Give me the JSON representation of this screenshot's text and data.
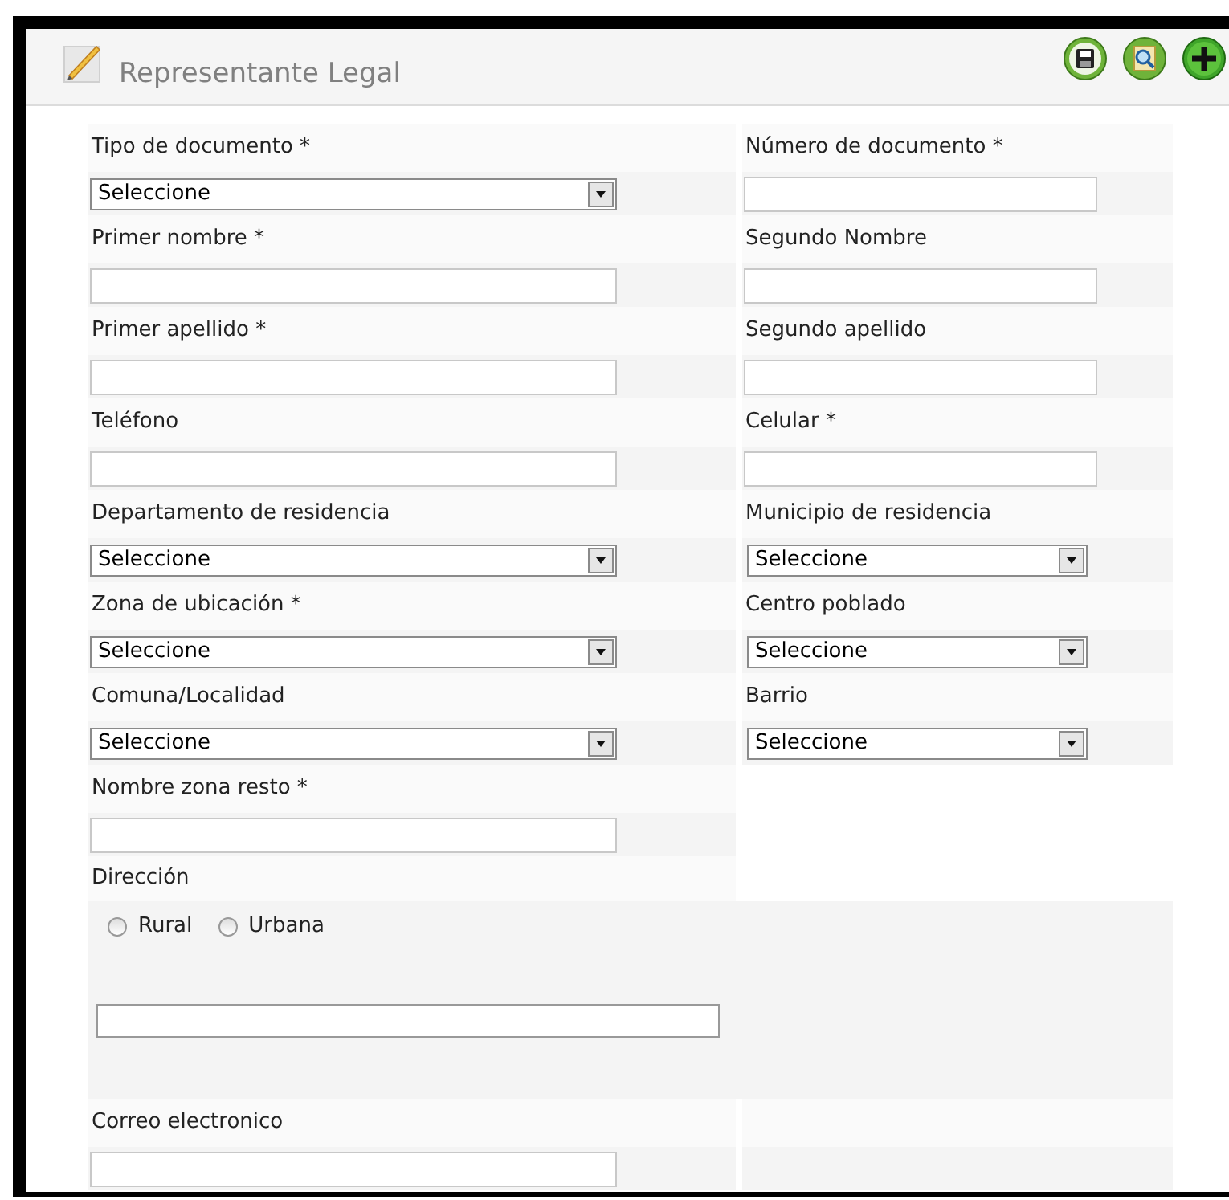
{
  "panel": {
    "title": "Representante Legal"
  },
  "rows": [
    {
      "left": {
        "label": "Tipo de documento *",
        "kind": "select",
        "value": "Seleccione"
      },
      "right": {
        "label": "Número de documento *",
        "kind": "text"
      }
    },
    {
      "left": {
        "label": "Primer nombre *",
        "kind": "text"
      },
      "right": {
        "label": "Segundo Nombre",
        "kind": "text"
      }
    },
    {
      "left": {
        "label": "Primer apellido *",
        "kind": "text"
      },
      "right": {
        "label": "Segundo apellido",
        "kind": "text"
      }
    },
    {
      "left": {
        "label": "Teléfono",
        "kind": "text"
      },
      "right": {
        "label": "Celular *",
        "kind": "text"
      }
    },
    {
      "left": {
        "label": "Departamento de residencia",
        "kind": "select",
        "value": "Seleccione"
      },
      "right": {
        "label": "Municipio de residencia",
        "kind": "select",
        "value": "Seleccione"
      }
    },
    {
      "left": {
        "label": "Zona de ubicación *",
        "kind": "select",
        "value": "Seleccione"
      },
      "right": {
        "label": "Centro poblado",
        "kind": "select",
        "value": "Seleccione"
      }
    },
    {
      "left": {
        "label": "Comuna/Localidad",
        "kind": "select",
        "value": "Seleccione"
      },
      "right": {
        "label": "Barrio",
        "kind": "select",
        "value": "Seleccione"
      }
    },
    {
      "left": {
        "label": "Nombre zona resto *",
        "kind": "text"
      }
    }
  ],
  "address": {
    "label": "Dirección",
    "options": [
      {
        "label": "Rural",
        "selected": false
      },
      {
        "label": "Urbana",
        "selected": false
      }
    ]
  },
  "email": {
    "label": "Correo electronico"
  }
}
